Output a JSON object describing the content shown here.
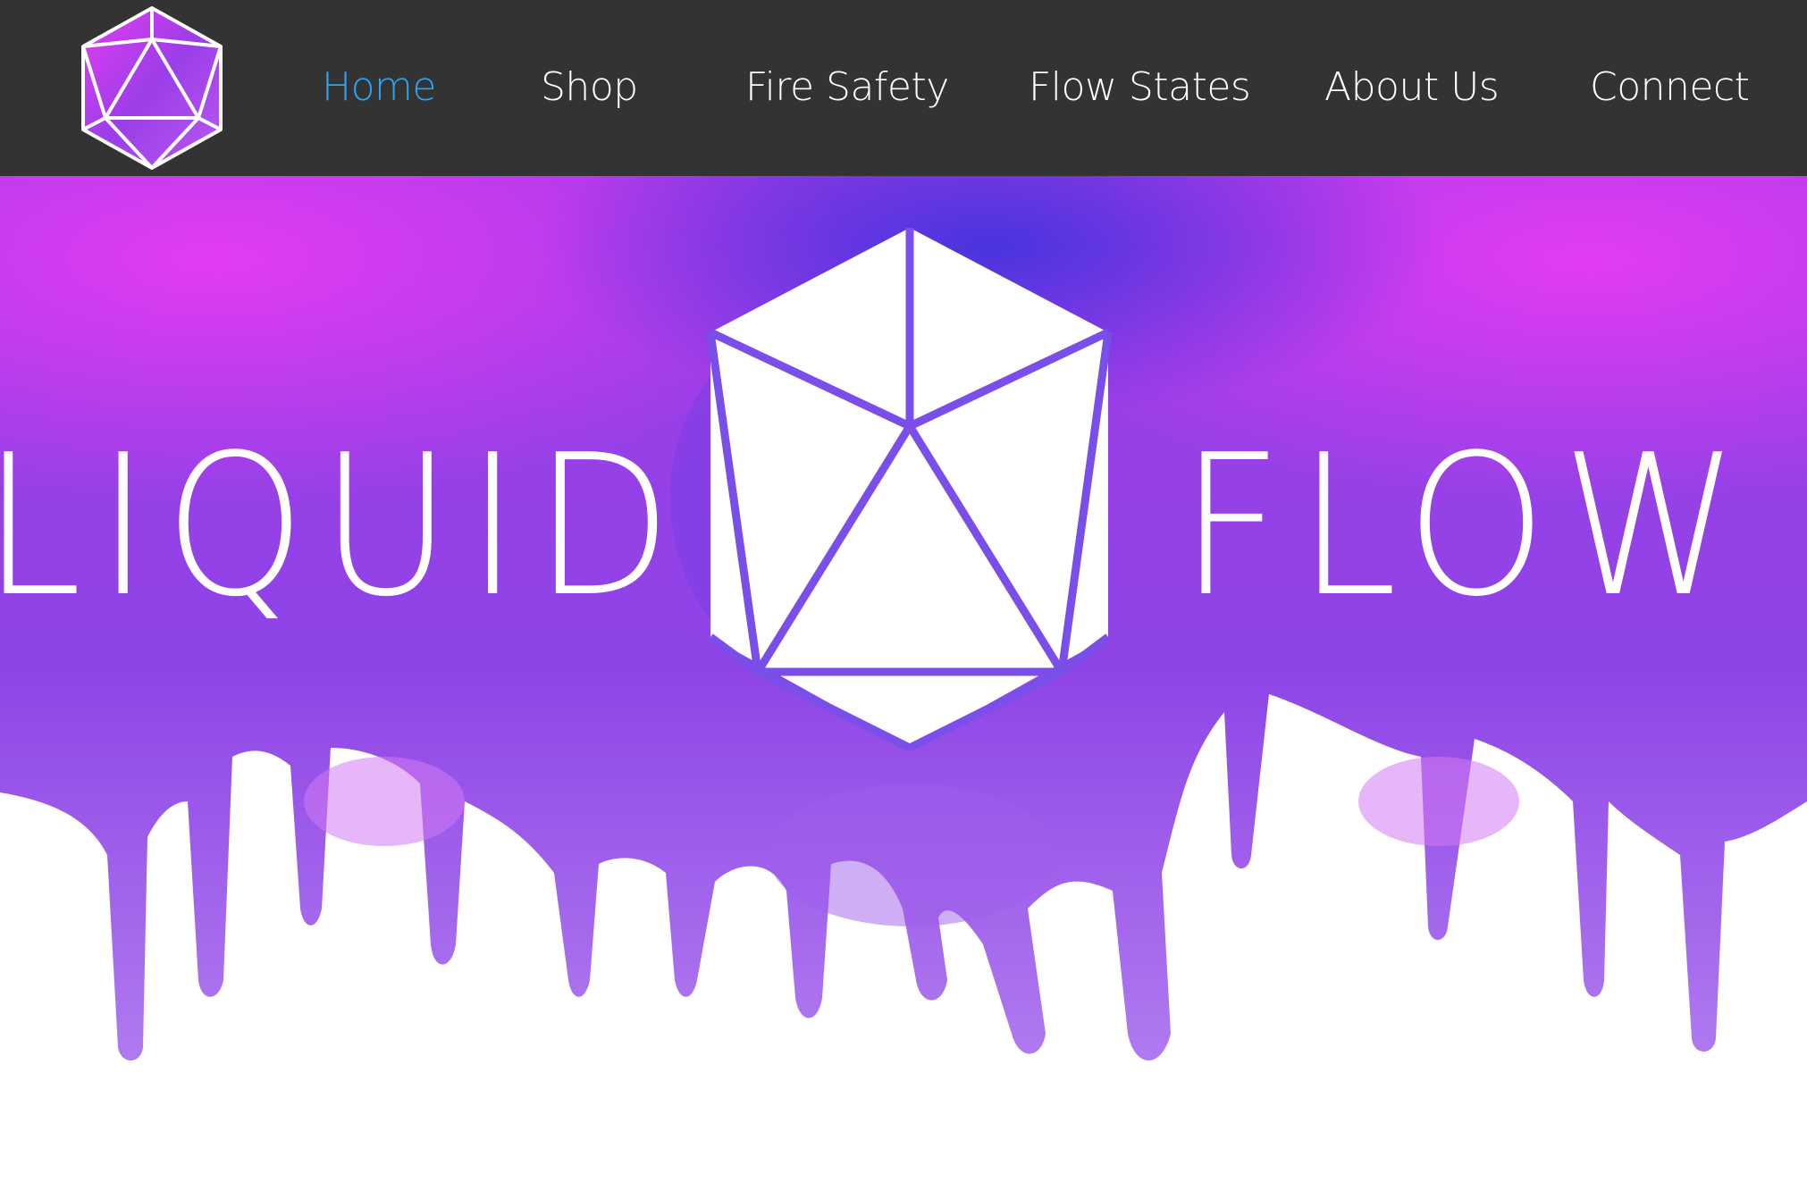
{
  "nav": {
    "items": [
      {
        "label": "Home",
        "active": true
      },
      {
        "label": "Shop",
        "active": false
      },
      {
        "label": "Fire Safety",
        "active": false
      },
      {
        "label": "Flow States",
        "active": false
      },
      {
        "label": "About Us",
        "active": false
      },
      {
        "label": "Connect",
        "active": false
      }
    ]
  },
  "hero": {
    "word_left": "LIQUID",
    "word_right": "FLOW"
  },
  "icons": {
    "site_logo": "icosahedron-logo-icon",
    "hero_emblem": "icosahedron-icon"
  },
  "colors": {
    "topbar": "#333333",
    "nav_active": "#2ea3f2",
    "nav_text": "#ffffff",
    "paint_magenta": "#e23cf0",
    "paint_violet": "#8a3ee6",
    "paint_blue": "#4a3fe0"
  }
}
